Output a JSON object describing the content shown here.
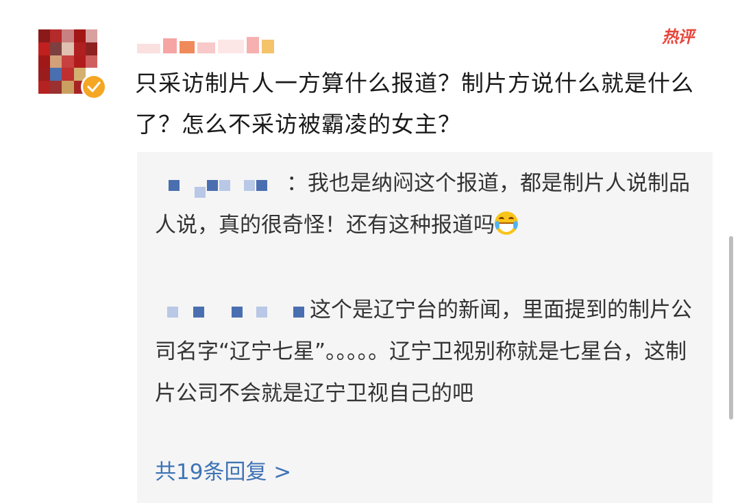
{
  "comment": {
    "text": "只采访制片人一方算什么报道？制片方说什么就是什么了？怎么不采访被霸凌的女主？",
    "hot_label": "热评"
  },
  "replies": [
    {
      "text": "：我也是纳闷这个报道，都是制片人说制品人说，真的很奇怪！还有这种报道吗",
      "emoji": "laugh-cry-emoji"
    },
    {
      "text": "这个是辽宁台的新闻，里面提到的制片公司名字“辽宁七星”。。。。。辽宁卫视别称就是七星台，这制片公司不会就是辽宁卫视自己的吧"
    }
  ],
  "more_replies": "共19条回复 >",
  "colors": {
    "hot_badge": "#e8453c",
    "link": "#3f74b5",
    "verified": "#f5a623",
    "reply_bg": "#f5f5f5"
  }
}
